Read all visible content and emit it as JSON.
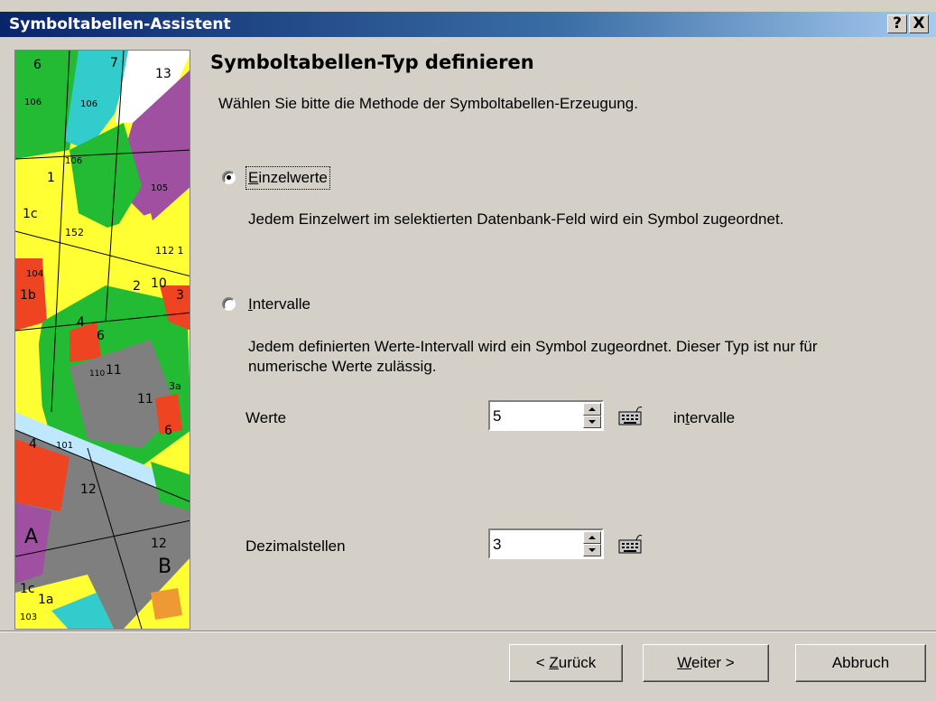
{
  "window": {
    "title": "Symboltabellen-Assistent",
    "help_button": "?",
    "close_button": "X"
  },
  "page": {
    "heading": "Symboltabellen-Typ definieren",
    "intro": "Wählen Sie bitte die Methode der Symboltabellen-Erzeugung."
  },
  "options": {
    "einzelwerte": {
      "label_u": "E",
      "label_rest": "inzelwerte",
      "selected": true,
      "description": "Jedem Einzelwert im selektierten Datenbank-Feld wird ein Symbol zugeordnet."
    },
    "intervalle": {
      "label_u": "I",
      "label_rest": "ntervalle",
      "selected": false,
      "description": "Jedem definierten Werte-Intervall wird ein Symbol zugeordnet. Dieser Typ ist nur für numerische Werte zulässig."
    }
  },
  "fields": {
    "werte": {
      "label": "Werte",
      "value": "5",
      "unit_pre": "in",
      "unit_u": "t",
      "unit_post": "ervalle"
    },
    "dezimalstellen": {
      "label": "Dezimalstellen",
      "value": "3"
    }
  },
  "buttons": {
    "back_pre": "< ",
    "back_u": "Z",
    "back_post": "urück",
    "next_u": "W",
    "next_post": "eiter >",
    "cancel": "Abbruch"
  },
  "sidebar_map": {
    "labels": [
      "6",
      "7",
      "13",
      "106",
      "106",
      "106",
      "105",
      "1",
      "1c",
      "152",
      "112",
      "1",
      "104",
      "1b",
      "2",
      "10",
      "3",
      "4",
      "6",
      "11",
      "11",
      "11",
      "3a",
      "6",
      "4",
      "101",
      "12",
      "A",
      "12",
      "B",
      "1a",
      "1c",
      "103"
    ]
  },
  "colors": {
    "titlebar_start": "#0a246a",
    "dialog_bg": "#d4d0c8"
  }
}
